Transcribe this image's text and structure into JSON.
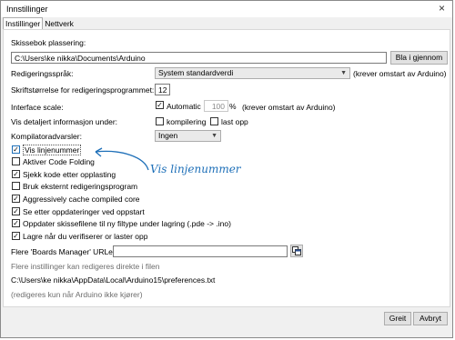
{
  "window": {
    "title": "Innstillinger",
    "close_glyph": "×"
  },
  "tabs": [
    {
      "label": "Instillinger"
    },
    {
      "label": "Nettverk"
    }
  ],
  "sketchbook": {
    "label": "Skissebok plassering:",
    "path": "C:\\Users\\ke nikka\\Documents\\Arduino",
    "browse_label": "Bla i gjennom"
  },
  "language": {
    "label": "Redigeringsspråk:",
    "value": "System standardverdi",
    "note": "(krever omstart av Arduino)"
  },
  "font_size": {
    "label": "Skriftstørrelse for redigeringsprogrammet:",
    "value": "12"
  },
  "interface_scale": {
    "label": "Interface scale:",
    "auto_label": "Automatic",
    "value": "100",
    "unit": "%",
    "note": "(krever omstart av Arduino)"
  },
  "verbose": {
    "label": "Vis detaljert informasjon under:",
    "compile_label": "kompilering",
    "upload_label": "last opp"
  },
  "compiler_warnings": {
    "label": "Kompilatoradvarsler:",
    "value": "Ingen"
  },
  "options": [
    {
      "label": "Vis linjenummer",
      "checked": true
    },
    {
      "label": "Aktiver Code Folding",
      "checked": false
    },
    {
      "label": "Sjekk kode etter opplasting",
      "checked": true
    },
    {
      "label": "Bruk eksternt redigeringsprogram",
      "checked": false
    },
    {
      "label": "Aggressively cache compiled core",
      "checked": true
    },
    {
      "label": "Se etter oppdateringer ved oppstart",
      "checked": true
    },
    {
      "label": "Oppdater skissefilene til ny filtype under lagring (.pde -> .ino)",
      "checked": true
    },
    {
      "label": "Lagre når du verifiserer or laster opp",
      "checked": true
    }
  ],
  "boards_manager": {
    "label": "Flere 'Boards Manager' URLer:",
    "value": ""
  },
  "more_prefs_note": "Flere instillinger kan redigeres direkte i filen",
  "prefs_path": "C:\\Users\\ke nikka\\AppData\\Local\\Arduino15\\preferences.txt",
  "edit_note": "(redigeres kun når Arduino ikke kjører)",
  "buttons": {
    "ok": "Greit",
    "cancel": "Avbryt"
  },
  "annotation": {
    "text": "Vis linjenummer",
    "color": "#1d6fb8"
  },
  "check_glyph": "✓"
}
